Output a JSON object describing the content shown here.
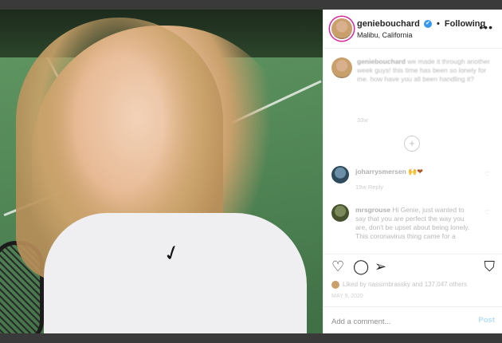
{
  "header": {
    "username": "geniebouchard",
    "verified_glyph": "✔",
    "separator": "•",
    "follow_status": "Following",
    "location": "Malibu, California",
    "more_glyph": "•••"
  },
  "caption": {
    "username": "geniebouchard",
    "text": " we made it through another week guys! this time has been so lonely for me. how have you all been handling it?",
    "time": "33w"
  },
  "load_more_glyph": "+",
  "comments": [
    {
      "username": "joharrysmersen",
      "text": "",
      "emoji": "🙌❤",
      "meta": "19w   Reply",
      "heart_glyph": "♡"
    },
    {
      "username": "mrsgrouse",
      "text": " Hi Genie, just wanted to say that you are perfect the way you are, don't be upset about being lonely. This coronavirus thing came for a",
      "meta": "",
      "heart_glyph": "♡"
    }
  ],
  "actions": {
    "heart_glyph": "♡",
    "comment_glyph": "◯",
    "share_glyph": "➢",
    "save_glyph": "⛉"
  },
  "likes_text": "Liked by nassimbrassky and 137,047 others",
  "post_date": "MAY 9, 2020",
  "add_comment": {
    "placeholder": "Add a comment...",
    "post_label": "Post"
  }
}
